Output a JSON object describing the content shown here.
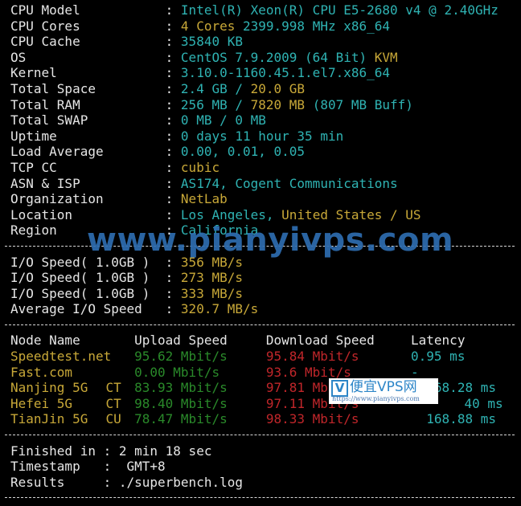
{
  "system_info": [
    {
      "label": "CPU Model",
      "parts": [
        {
          "t": "Intel(R) Xeon(R) CPU E5-2680 v4 @ 2.40GHz",
          "c": "c"
        }
      ]
    },
    {
      "label": "CPU Cores",
      "parts": [
        {
          "t": "4 Cores",
          "c": "y"
        },
        {
          "t": " 2399.998 MHz x86_64",
          "c": "c"
        }
      ]
    },
    {
      "label": "CPU Cache",
      "parts": [
        {
          "t": "35840 KB",
          "c": "c"
        }
      ]
    },
    {
      "label": "OS",
      "parts": [
        {
          "t": "CentOS 7.9.2009 (64 Bit) ",
          "c": "c"
        },
        {
          "t": "KVM",
          "c": "y"
        }
      ]
    },
    {
      "label": "Kernel",
      "parts": [
        {
          "t": "3.10.0-1160.45.1.el7.x86_64",
          "c": "c"
        }
      ]
    },
    {
      "label": "Total Space",
      "parts": [
        {
          "t": "2.4 GB / ",
          "c": "c"
        },
        {
          "t": "20.0 GB",
          "c": "y"
        }
      ]
    },
    {
      "label": "Total RAM",
      "parts": [
        {
          "t": "256 MB / ",
          "c": "c"
        },
        {
          "t": "7820 MB",
          "c": "y"
        },
        {
          "t": " (807 MB Buff)",
          "c": "c"
        }
      ]
    },
    {
      "label": "Total SWAP",
      "parts": [
        {
          "t": "0 MB / 0 MB",
          "c": "c"
        }
      ]
    },
    {
      "label": "Uptime",
      "parts": [
        {
          "t": "0 days 11 hour 35 min",
          "c": "c"
        }
      ]
    },
    {
      "label": "Load Average",
      "parts": [
        {
          "t": "0.00, 0.01, 0.05",
          "c": "c"
        }
      ]
    },
    {
      "label": "TCP CC",
      "parts": [
        {
          "t": "cubic",
          "c": "y"
        }
      ]
    },
    {
      "label": "ASN & ISP",
      "parts": [
        {
          "t": "AS174, Cogent Communications",
          "c": "c"
        }
      ]
    },
    {
      "label": "Organization",
      "parts": [
        {
          "t": "NetLab",
          "c": "y"
        }
      ]
    },
    {
      "label": "Location",
      "parts": [
        {
          "t": "Los Angeles, ",
          "c": "c"
        },
        {
          "t": "United States / US",
          "c": "y"
        }
      ]
    },
    {
      "label": "Region",
      "parts": [
        {
          "t": "California",
          "c": "c"
        }
      ]
    }
  ],
  "io": [
    {
      "label": "I/O Speed( 1.0GB )",
      "value": "356 MB/s"
    },
    {
      "label": "I/O Speed( 1.0GB )",
      "value": "273 MB/s"
    },
    {
      "label": "I/O Speed( 1.0GB )",
      "value": "333 MB/s"
    },
    {
      "label": "Average I/O Speed",
      "value": "320.7 MB/s"
    }
  ],
  "speed_table": {
    "headers": [
      "Node Name",
      "Upload Speed",
      "Download Speed",
      "Latency"
    ],
    "rows": [
      {
        "node": "Speedtest.net",
        "isp": "",
        "upload": "95.62 Mbit/s",
        "download": "95.84 Mbit/s",
        "latency": "0.95 ms"
      },
      {
        "node": "Fast.com",
        "isp": "",
        "upload": "0.00 Mbit/s",
        "download": "93.6 Mbit/s",
        "latency": "-"
      },
      {
        "node": "Nanjing 5G",
        "isp": "CT",
        "upload": "83.93 Mbit/s",
        "download": "97.81 Mbit/s",
        "latency": "168.28 ms"
      },
      {
        "node": "Hefei 5G",
        "isp": "CT",
        "upload": "98.40 Mbit/s",
        "download": "97.11 Mbit/s",
        "latency": "40 ms"
      },
      {
        "node": "TianJin 5G",
        "isp": "CU",
        "upload": "78.47 Mbit/s",
        "download": "98.33 Mbit/s",
        "latency": "168.88 ms"
      }
    ]
  },
  "summary": [
    {
      "label": "Finished in",
      "value": "2 min 18 sec"
    },
    {
      "label": "Timestamp",
      "value": " GMT+8"
    },
    {
      "label": "Results",
      "value": "./superbench.log"
    }
  ],
  "watermark": {
    "main": "www.pianyivps.com",
    "badge_letter": "V",
    "badge_title": "便宜VPS网",
    "badge_url": "https://www.pianyivps.com"
  }
}
